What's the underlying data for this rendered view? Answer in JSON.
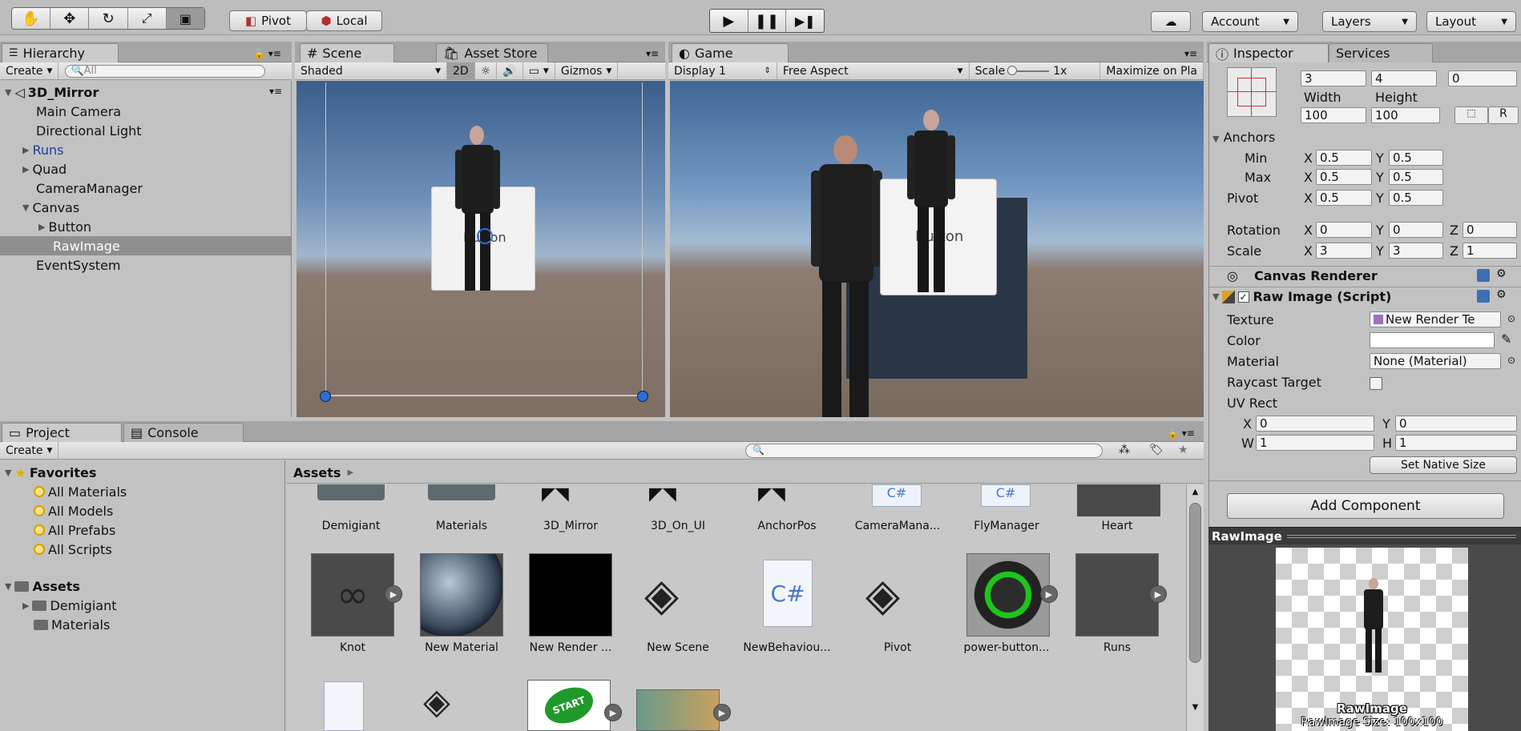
{
  "toolbar": {
    "pivot_label": "Pivot",
    "local_label": "Local",
    "account_label": "Account",
    "layers_label": "Layers",
    "layout_label": "Layout"
  },
  "hierarchy": {
    "tab_label": "Hierarchy",
    "create_label": "Create",
    "search_placeholder": "All",
    "scene_name": "3D_Mirror",
    "items": [
      {
        "label": "Main Camera"
      },
      {
        "label": "Directional Light"
      },
      {
        "label": "Runs"
      },
      {
        "label": "Quad"
      },
      {
        "label": "CameraManager"
      },
      {
        "label": "Canvas"
      },
      {
        "label": "Button"
      },
      {
        "label": "RawImage"
      },
      {
        "label": "EventSystem"
      }
    ]
  },
  "scene": {
    "tab_label": "Scene",
    "asset_store_tab": "Asset Store",
    "shading_mode": "Shaded",
    "mode_2d": "2D",
    "gizmos_label": "Gizmos",
    "button_text": "Button"
  },
  "game": {
    "tab_label": "Game",
    "display": "Display 1",
    "aspect": "Free Aspect",
    "scale_label": "Scale",
    "scale_value": "1x",
    "maximize_label": "Maximize on Pla",
    "button_text": "Button"
  },
  "inspector": {
    "tab_label": "Inspector",
    "services_tab": "Services",
    "pos_values": [
      "3",
      "4",
      "0"
    ],
    "width_label": "Width",
    "height_label": "Height",
    "width_value": "100",
    "height_value": "100",
    "r_button": "R",
    "anchors_label": "Anchors",
    "min_label": "Min",
    "max_label": "Max",
    "pivot_label": "Pivot",
    "anchor_min": {
      "x": "0.5",
      "y": "0.5"
    },
    "anchor_max": {
      "x": "0.5",
      "y": "0.5"
    },
    "pivot": {
      "x": "0.5",
      "y": "0.5"
    },
    "rotation_label": "Rotation",
    "rotation": {
      "x": "0",
      "y": "0",
      "z": "0"
    },
    "scale_label": "Scale",
    "scale": {
      "x": "3",
      "y": "3",
      "z": "1"
    },
    "canvas_renderer": "Canvas Renderer",
    "raw_image_script": "Raw Image (Script)",
    "texture_label": "Texture",
    "texture_value": "New Render Te",
    "color_label": "Color",
    "material_label": "Material",
    "material_value": "None (Material)",
    "raycast_label": "Raycast Target",
    "uv_rect_label": "UV Rect",
    "uv": {
      "x": "0",
      "y": "0",
      "w": "1",
      "h": "1"
    },
    "set_native_size": "Set Native Size",
    "add_component": "Add Component",
    "preview_title": "RawImage",
    "preview_caption": "RawImage",
    "preview_size": "RawImage Size: 100x100"
  },
  "project": {
    "tab_label": "Project",
    "console_tab": "Console",
    "create_label": "Create",
    "favorites_label": "Favorites",
    "favorites": [
      "All Materials",
      "All Models",
      "All Prefabs",
      "All Scripts"
    ],
    "assets_label": "Assets",
    "asset_folders": [
      "Demigiant",
      "Materials"
    ],
    "breadcrumb": "Assets",
    "row1": [
      "Demigiant",
      "Materials",
      "3D_Mirror",
      "3D_On_UI",
      "AnchorPos",
      "CameraMana...",
      "FlyManager",
      "Heart"
    ],
    "row2": [
      "Knot",
      "New Material",
      "New Render ...",
      "New Scene",
      "NewBehaviou...",
      "Pivot",
      "power-button...",
      "Runs"
    ],
    "start_label": "START"
  }
}
